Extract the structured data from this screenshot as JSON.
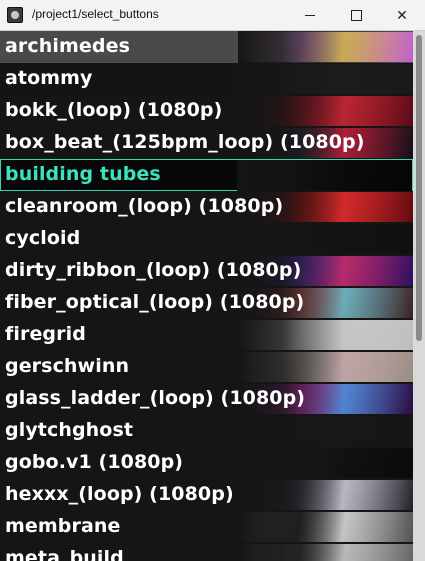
{
  "window": {
    "title": "/project1/select_buttons",
    "minimize_glyph": "",
    "maximize_glyph": "",
    "close_glyph": "✕"
  },
  "list": {
    "items": [
      {
        "label": "archimedes",
        "selected": false,
        "bg": "#4a4a4a",
        "thumb": [
          "#ffffff",
          "#d890e0",
          "#f5d060",
          "#c25fcf"
        ]
      },
      {
        "label": "atommy",
        "selected": false,
        "bg": "#141414",
        "thumb": [
          "#1a1a1a",
          "#222222",
          "#1d1d1d",
          "#1a1a1a"
        ]
      },
      {
        "label": "bokk_(loop) (1080p)",
        "selected": false,
        "bg": "#151515",
        "thumb": [
          "#2a0a10",
          "#a01020",
          "#e02a3a",
          "#5a0a18"
        ]
      },
      {
        "label": "box_beat_(125bpm_loop) (1080p)",
        "selected": false,
        "bg": "#151515",
        "thumb": [
          "#101015",
          "#2a2a3a",
          "#d02040",
          "#101018"
        ]
      },
      {
        "label": "building tubes",
        "selected": true,
        "bg": "#080808",
        "thumb": [
          "#050505",
          "#0a0a0a",
          "#080808",
          "#050505"
        ]
      },
      {
        "label": "cleanroom_(loop) (1080p)",
        "selected": false,
        "bg": "#151515",
        "thumb": [
          "#3a0a0a",
          "#b01010",
          "#ff3030",
          "#600a10"
        ]
      },
      {
        "label": "cycloid",
        "selected": false,
        "bg": "#151515",
        "thumb": [
          "#101010",
          "#141414",
          "#121212",
          "#101010"
        ]
      },
      {
        "label": "dirty_ribbon_(loop) (1080p)",
        "selected": false,
        "bg": "#151515",
        "thumb": [
          "#1a0a3a",
          "#6030c0",
          "#e03080",
          "#2a1060"
        ]
      },
      {
        "label": "fiber_optical_(loop) (1080p)",
        "selected": false,
        "bg": "#151515",
        "thumb": [
          "#2a1a1a",
          "#d06060",
          "#80d0e0",
          "#3a2020"
        ]
      },
      {
        "label": "firegrid",
        "selected": false,
        "bg": "#151515",
        "thumb": [
          "#d8d8d8",
          "#ffffff",
          "#f0f0f0",
          "#bdbdbd"
        ]
      },
      {
        "label": "gerschwinn",
        "selected": false,
        "bg": "#151515",
        "thumb": [
          "#dcd6d0",
          "#b0a8a0",
          "#e8c8c8",
          "#9a8c84"
        ]
      },
      {
        "label": "glass_ladder_(loop) (1080p)",
        "selected": false,
        "bg": "#151515",
        "thumb": [
          "#3a1050",
          "#e030c0",
          "#60a0ff",
          "#2a0a40"
        ]
      },
      {
        "label": "glytchghost",
        "selected": false,
        "bg": "#151515",
        "thumb": [
          "#151515",
          "#1a1a1a",
          "#181818",
          "#151515"
        ]
      },
      {
        "label": "gobo.v1 (1080p)",
        "selected": false,
        "bg": "#151515",
        "thumb": [
          "#0a0a0a",
          "#1a1a1a",
          "#101010",
          "#0a0a0a"
        ]
      },
      {
        "label": "hexxx_(loop) (1080p)",
        "selected": false,
        "bg": "#151515",
        "thumb": [
          "#1a1a20",
          "#404050",
          "#e0e0f0",
          "#202028"
        ]
      },
      {
        "label": "membrane",
        "selected": false,
        "bg": "#151515",
        "thumb": [
          "#e0e0e0",
          "#303030",
          "#f0f0f0",
          "#505050"
        ]
      },
      {
        "label": "meta_build",
        "selected": false,
        "bg": "#151515",
        "thumb": [
          "#c0c0c0",
          "#404040",
          "#e0e0e0",
          "#606060"
        ]
      }
    ]
  },
  "scrollbar": {
    "position_fraction": 0.0,
    "visible_fraction": 0.58
  }
}
